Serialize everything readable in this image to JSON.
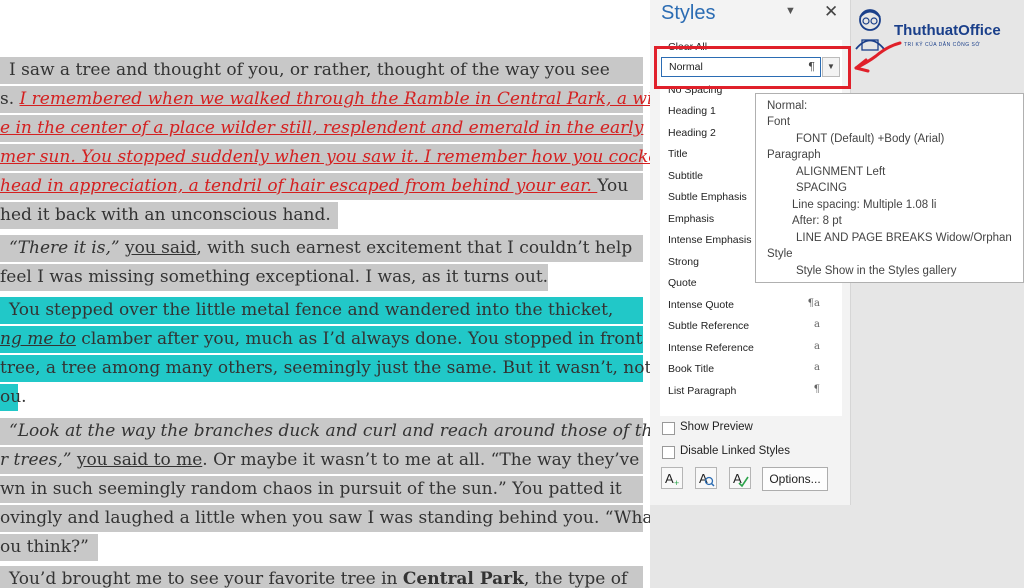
{
  "document": {
    "lines": [
      {
        "segs": [
          {
            "t": "I saw a tree and thought of you, or rather, thought of the way you see"
          }
        ]
      },
      {
        "segs": [
          {
            "t": "s. "
          },
          {
            "t": "I remembered when we walked through the Ramble in Central Park, a wild"
          }
        ]
      },
      {
        "segs": [
          {
            "t": "e in the center of a place wilder still, resplendent and emerald in the early"
          }
        ]
      },
      {
        "segs": [
          {
            "t": "mer sun. You stopped suddenly when you saw it. I remember how you cocked"
          }
        ]
      },
      {
        "segs": [
          {
            "t": "head in appreciation, a tendril of hair escaped from behind your ear. "
          },
          {
            "t": "You"
          }
        ]
      },
      {
        "segs": [
          {
            "t": "hed it back with an unconscious hand."
          }
        ]
      },
      {
        "segs": [
          {
            "t": "“There it is,”"
          },
          {
            "t": " "
          },
          {
            "t": "you said"
          },
          {
            "t": ", with such earnest excitement that I couldn’t help"
          }
        ]
      },
      {
        "segs": [
          {
            "t": "feel I was missing something exceptional. I was, as it turns out."
          }
        ]
      },
      {
        "segs": [
          {
            "t": "You stepped over the little metal fence and wandered into the thicket,"
          }
        ]
      },
      {
        "segs": [
          {
            "t": "ng me to"
          },
          {
            "t": " clamber after you, much as I’d always done. You stopped in front"
          }
        ]
      },
      {
        "segs": [
          {
            "t": "tree, a tree among many others, seemingly just the same. But it wasn’t, not"
          }
        ]
      },
      {
        "segs": [
          {
            "t": "ou."
          }
        ]
      },
      {
        "segs": [
          {
            "t": "“Look at the way the branches duck and curl and reach around those of the"
          }
        ]
      },
      {
        "segs": [
          {
            "t": "r trees,”"
          },
          {
            "t": " "
          },
          {
            "t": "you said to me"
          },
          {
            "t": ". Or maybe it wasn’t to me at all. “The way they’ve"
          }
        ]
      },
      {
        "segs": [
          {
            "t": "wn in such seemingly random chaos in pursuit of the sun.” You patted it"
          }
        ]
      },
      {
        "segs": [
          {
            "t": "ovingly and laughed a little when you saw I was standing behind you. “What"
          }
        ]
      },
      {
        "segs": [
          {
            "t": "ou think?”"
          }
        ]
      },
      {
        "segs": [
          {
            "t": "You’d brought me to see your favorite tree in "
          },
          {
            "t": "Central Park"
          },
          {
            "t": ", the type of"
          }
        ]
      }
    ]
  },
  "styles_pane": {
    "title": "Styles",
    "menu_glyph": "▼",
    "close_glyph": "✕",
    "clear_all": "Clear All",
    "normal": "Normal",
    "normal_mark": "¶",
    "no_spacing": "No Spacing",
    "items": [
      {
        "label": "Heading 1",
        "mark": ""
      },
      {
        "label": "Heading 2",
        "mark": ""
      },
      {
        "label": "Title",
        "mark": ""
      },
      {
        "label": "Subtitle",
        "mark": ""
      },
      {
        "label": "Subtle Emphasis",
        "mark": ""
      },
      {
        "label": "Emphasis",
        "mark": ""
      },
      {
        "label": "Intense Emphasis",
        "mark": ""
      },
      {
        "label": "Strong",
        "mark": ""
      },
      {
        "label": "Quote",
        "mark": ""
      },
      {
        "label": "Intense Quote",
        "mark": "¶a"
      },
      {
        "label": "Subtle Reference",
        "mark": "a"
      },
      {
        "label": "Intense Reference",
        "mark": "a"
      },
      {
        "label": "Book Title",
        "mark": "a"
      },
      {
        "label": "List Paragraph",
        "mark": "¶"
      }
    ],
    "show_preview": "Show Preview",
    "disable_linked": "Disable Linked Styles",
    "options": "Options..."
  },
  "tooltip": {
    "l1": "Normal:",
    "l2": "Font",
    "l3": "FONT  (Default) +Body (Arial)",
    "l4": "Paragraph",
    "l5": "ALIGNMENT  Left",
    "l6": "SPACING",
    "l7": "Line spacing:  Multiple 1.08 li",
    "l8": "After:  8 pt",
    "l9": "LINE AND PAGE BREAKS  Widow/Orphan",
    "l10": "Style",
    "l11": "Style Show in the Styles gallery"
  },
  "logo": {
    "name": "ThuthuatOffice",
    "tagline": "TRI KỶ CỦA DÂN CÔNG SỞ"
  },
  "colors": {
    "accent_blue": "#2b6cb3",
    "highlight_red": "#e0202a",
    "selection_cyan": "#21c8c8",
    "selection_gray": "#c8c8c8"
  }
}
